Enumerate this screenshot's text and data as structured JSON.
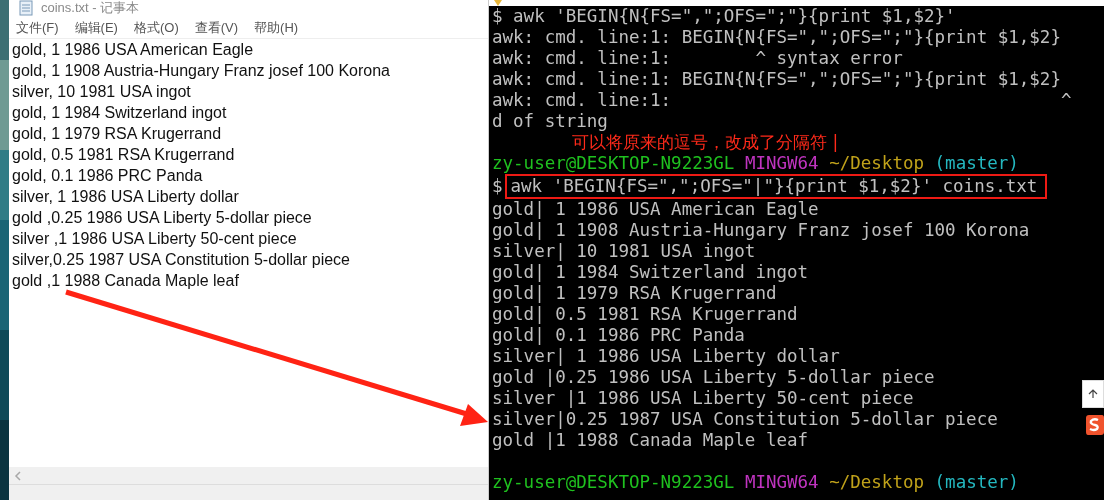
{
  "notepad": {
    "title": "coins.txt - 记事本",
    "menu": [
      "文件(F)",
      "编辑(E)",
      "格式(O)",
      "查看(V)",
      "帮助(H)"
    ],
    "lines": [
      "gold, 1 1986 USA American Eagle",
      "gold, 1 1908 Austria-Hungary Franz josef 100 Korona",
      "silver, 10 1981 USA ingot",
      "gold, 1 1984 Switzerland ingot",
      "gold, 1 1979 RSA Krugerrand",
      "gold, 0.5 1981 RSA Krugerrand",
      "gold, 0.1 1986 PRC Panda",
      "silver, 1 1986 USA Liberty dollar",
      "gold ,0.25 1986 USA Liberty 5-dollar piece",
      "silver ,1 1986 USA Liberty 50-cent piece",
      "silver,0.25 1987 USA Constitution 5-dollar piece",
      "gold ,1 1988 Canada Maple leaf"
    ]
  },
  "terminal": {
    "lines": [
      {
        "kind": "text",
        "text": "$ awk 'BEGIN{N{FS=\",\";OFS=\";\"}{print $1,$2}'"
      },
      {
        "kind": "text",
        "text": "awk: cmd. line:1: BEGIN{N{FS=\",\";OFS=\";\"}{print $1,$2}"
      },
      {
        "kind": "text",
        "text": "awk: cmd. line:1:        ^ syntax error"
      },
      {
        "kind": "text",
        "text": "awk: cmd. line:1: BEGIN{N{FS=\",\";OFS=\";\"}{print $1,$2}"
      },
      {
        "kind": "text",
        "text": "awk: cmd. line:1:                                     ^"
      },
      {
        "kind": "text",
        "text": "d of string"
      },
      {
        "kind": "annotation",
        "text": "可以将原来的逗号，改成了分隔符 |"
      },
      {
        "kind": "prompt",
        "user": "zy-user@DESKTOP-N9223GL",
        "system": "MINGW64",
        "path": "~/Desktop",
        "branch": "(master)"
      },
      {
        "kind": "command",
        "prefix": "$",
        "text": "awk 'BEGIN{FS=\",\";OFS=\"|\"}{print $1,$2}' coins.txt"
      },
      {
        "kind": "text",
        "text": "gold| 1 1986 USA American Eagle"
      },
      {
        "kind": "text",
        "text": "gold| 1 1908 Austria-Hungary Franz josef 100 Korona"
      },
      {
        "kind": "text",
        "text": "silver| 10 1981 USA ingot"
      },
      {
        "kind": "text",
        "text": "gold| 1 1984 Switzerland ingot"
      },
      {
        "kind": "text",
        "text": "gold| 1 1979 RSA Krugerrand"
      },
      {
        "kind": "text",
        "text": "gold| 0.5 1981 RSA Krugerrand"
      },
      {
        "kind": "text",
        "text": "gold| 0.1 1986 PRC Panda"
      },
      {
        "kind": "text",
        "text": "silver| 1 1986 USA Liberty dollar"
      },
      {
        "kind": "text",
        "text": "gold |0.25 1986 USA Liberty 5-dollar piece"
      },
      {
        "kind": "text",
        "text": "silver |1 1986 USA Liberty 50-cent piece"
      },
      {
        "kind": "text",
        "text": "silver|0.25 1987 USA Constitution 5-dollar piece"
      },
      {
        "kind": "text",
        "text": "gold |1 1988 Canada Maple leaf"
      },
      {
        "kind": "blank"
      },
      {
        "kind": "prompt",
        "user": "zy-user@DESKTOP-N9223GL",
        "system": "MINGW64",
        "path": "~/Desktop",
        "branch": "(master)"
      }
    ]
  }
}
